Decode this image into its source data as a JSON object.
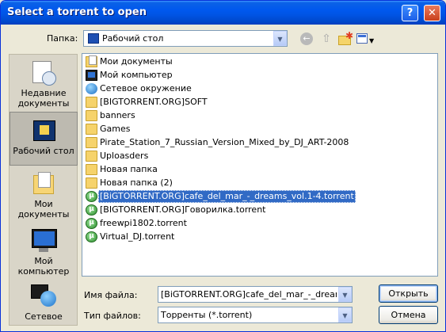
{
  "window": {
    "title": "Select a torrent to open",
    "help_label": "?",
    "close_label": "✕"
  },
  "toolbar": {
    "look_in_label": "Папка:",
    "look_in_value": "Рабочий стол"
  },
  "places": [
    {
      "label_lines": [
        "Недавние",
        "документы"
      ],
      "icon": "recent-documents-icon"
    },
    {
      "label_lines": [
        "Рабочий стол"
      ],
      "icon": "desktop-icon"
    },
    {
      "label_lines": [
        "Мои документы"
      ],
      "icon": "my-documents-icon"
    },
    {
      "label_lines": [
        "Мой",
        "компьютер"
      ],
      "icon": "my-computer-icon"
    },
    {
      "label_lines": [
        "Сетевое"
      ],
      "icon": "network-icon"
    }
  ],
  "files": [
    {
      "name": "Мои документы",
      "type": "docs"
    },
    {
      "name": "Мой компьютер",
      "type": "comp"
    },
    {
      "name": "Сетевое окружение",
      "type": "net"
    },
    {
      "name": "[BIGTORRENT.ORG]SOFT",
      "type": "folder"
    },
    {
      "name": "banners",
      "type": "folder"
    },
    {
      "name": "Games",
      "type": "folder"
    },
    {
      "name": "Pirate_Station_7_Russian_Version_Mixed_by_DJ_ART-2008",
      "type": "folder"
    },
    {
      "name": "Uploasders",
      "type": "folder"
    },
    {
      "name": "Новая папка",
      "type": "folder"
    },
    {
      "name": "Новая папка (2)",
      "type": "folder"
    },
    {
      "name": "[BiGTORRENT.ORG]cafe_del_mar_-_dreams_vol.1-4.torrent",
      "type": "torrent",
      "selected": true
    },
    {
      "name": "[BIGTORRENT.ORG]Говорилка.torrent",
      "type": "torrent"
    },
    {
      "name": "freewpi1802.torrent",
      "type": "torrent"
    },
    {
      "name": "Virtual_DJ.torrent",
      "type": "torrent"
    }
  ],
  "bottom": {
    "file_name_label": "Имя файла:",
    "file_name_value": "[BiGTORRENT.ORG]cafe_del_mar_-_dreams_",
    "file_type_label": "Тип файлов:",
    "file_type_value": "Торренты (*.torrent)",
    "open_label": "Открыть",
    "cancel_label": "Отмена"
  }
}
